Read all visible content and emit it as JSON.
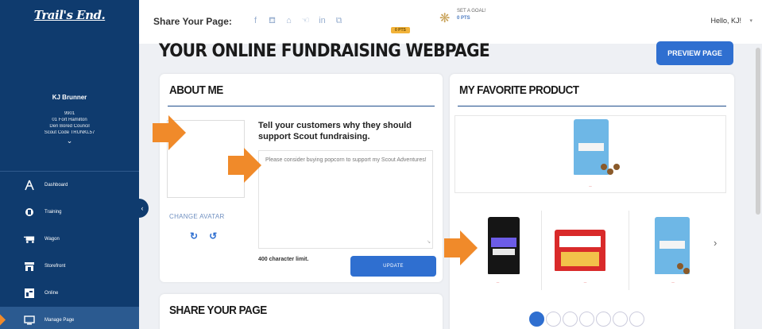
{
  "sidebar": {
    "logo": "Trail's End.",
    "profile": {
      "name": "KJ Brunner",
      "lines": [
        "9901",
        "01 Fort Hamilton",
        "Den Bored Council",
        "Scout Code  TRUNKL57"
      ]
    },
    "nav": [
      {
        "label": "Dashboard",
        "icon": "compass-icon"
      },
      {
        "label": "Training",
        "icon": "training-icon"
      },
      {
        "label": "Wagon",
        "icon": "wagon-icon"
      },
      {
        "label": "Storefront",
        "icon": "storefront-icon"
      },
      {
        "label": "Online",
        "icon": "online-icon"
      },
      {
        "label": "Manage Page",
        "icon": "monitor-icon"
      }
    ]
  },
  "topbar": {
    "share_label": "Share Your Page:",
    "goal_line1": "SET A GOAL!",
    "goal_pts": "0 PTS",
    "goal_badge": "0 PTS",
    "greeting": "Hello, KJ!"
  },
  "main": {
    "page_title": "YOUR ONLINE FUNDRAISING WEBPAGE",
    "preview_button": "PREVIEW PAGE",
    "about": {
      "title": "ABOUT ME",
      "prompt": "Tell your customers why they should support Scout fundraising.",
      "text": "Please consider buying popcorn to support my Scout Adventures!",
      "change_avatar": "CHANGE AVATAR",
      "char_limit": "400 character limit.",
      "update_button": "UPDATE"
    },
    "share": {
      "title": "SHARE YOUR PAGE"
    },
    "favorite": {
      "title": "MY FAVORITE PRODUCT"
    }
  },
  "colors": {
    "sidebar": "#0f3b6e",
    "accent": "#2f6fd0",
    "arrow": "#f08a2a"
  }
}
